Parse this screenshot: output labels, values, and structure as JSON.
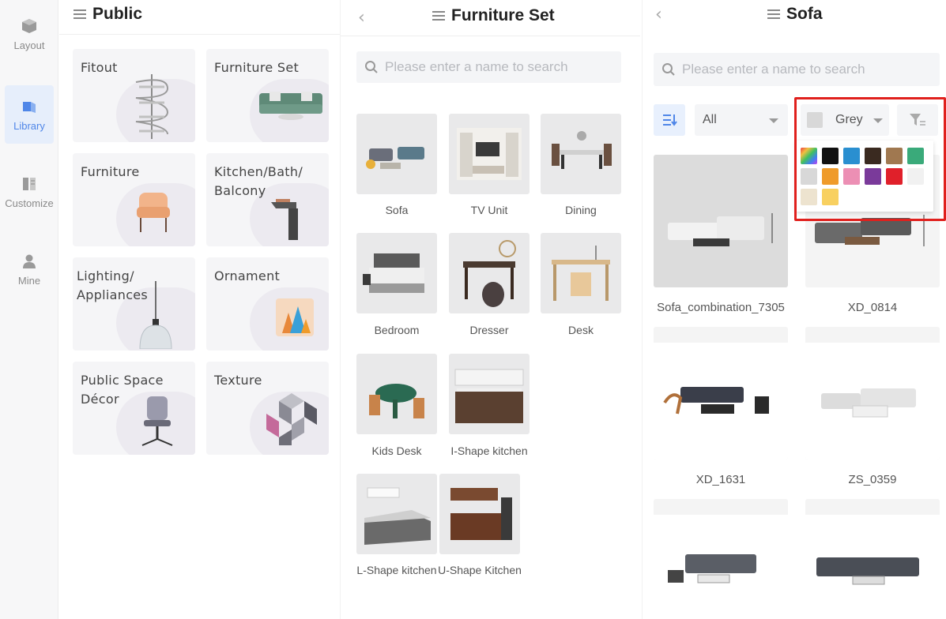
{
  "rail": {
    "items": [
      {
        "label": "Layout",
        "icon": "layout-cube-icon",
        "active": false
      },
      {
        "label": "Library",
        "icon": "library-cube-icon",
        "active": true
      },
      {
        "label": "Customize",
        "icon": "customize-book-icon",
        "active": false
      },
      {
        "label": "Mine",
        "icon": "user-icon",
        "active": false
      }
    ]
  },
  "public_panel": {
    "title": "Public",
    "categories": [
      {
        "label": "Fitout",
        "icon": "spiral-stair-icon"
      },
      {
        "label": "Furniture Set",
        "icon": "sofa-icon"
      },
      {
        "label": "Furniture",
        "icon": "armchair-icon"
      },
      {
        "label": "Kitchen/Bath/\nBalcony",
        "icon": "faucet-icon"
      },
      {
        "label": "Lighting/\nAppliances",
        "icon": "pendant-lamp-icon"
      },
      {
        "label": "Ornament",
        "icon": "pillow-icon"
      },
      {
        "label": "Public Space\nDécor",
        "icon": "office-chair-icon"
      },
      {
        "label": "Texture",
        "icon": "texture-cubes-icon"
      }
    ]
  },
  "set_panel": {
    "title": "Furniture Set",
    "search_placeholder": "Please enter a name to search",
    "tiles": [
      {
        "label": "Sofa"
      },
      {
        "label": "TV Unit"
      },
      {
        "label": "Dining"
      },
      {
        "label": "Bedroom"
      },
      {
        "label": "Dresser"
      },
      {
        "label": "Desk"
      },
      {
        "label": "Kids Desk"
      },
      {
        "label": "I-Shape kitchen"
      },
      {
        "label": "L-Shape kitchen"
      },
      {
        "label": "U-Shape Kitchen"
      }
    ]
  },
  "sofa_panel": {
    "title": "Sofa",
    "search_placeholder": "Please enter a name to search",
    "type_filter": "All",
    "color_filter": "Grey",
    "colors": [
      "multicolor",
      "#111111",
      "#2a8fd0",
      "#3a2a20",
      "#a07850",
      "#3aaa7a",
      "#d8d8d8",
      "#ef9b2a",
      "#ec8fb4",
      "#7a3a9a",
      "#e0202a",
      "#f1f1f1",
      "#ede3cf",
      "#f8d060"
    ],
    "products": [
      {
        "label": "Sofa_combination_7305"
      },
      {
        "label": "XD_0814"
      },
      {
        "label": "XD_1631"
      },
      {
        "label": "ZS_0359"
      },
      {
        "label": ""
      },
      {
        "label": ""
      }
    ]
  }
}
